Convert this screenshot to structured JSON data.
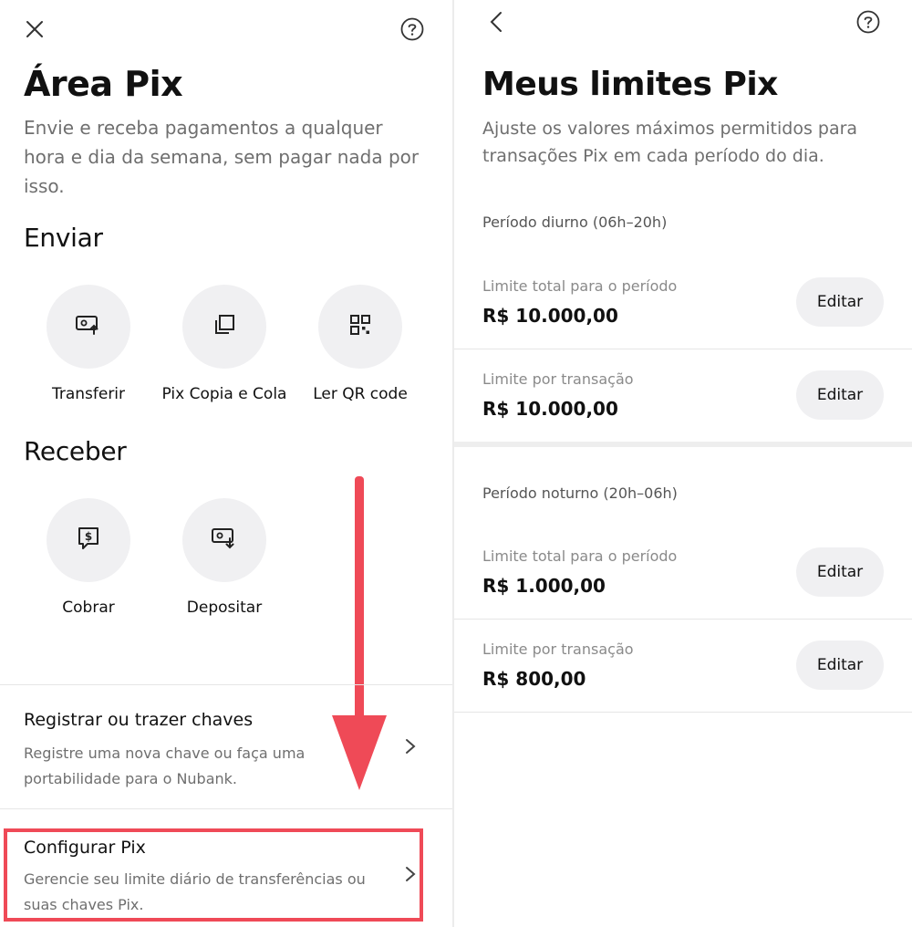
{
  "left": {
    "title": "Área Pix",
    "subtitle": "Envie e receba pagamentos a qualquer hora e dia da semana, sem pagar nada por isso.",
    "send_section": "Enviar",
    "send_actions": [
      {
        "label": "Transferir",
        "icon": "transfer-icon"
      },
      {
        "label": "Pix Copia e Cola",
        "icon": "copy-paste-icon"
      },
      {
        "label": "Ler QR code",
        "icon": "qr-code-icon"
      }
    ],
    "receive_section": "Receber",
    "receive_actions": [
      {
        "label": "Cobrar",
        "icon": "charge-icon"
      },
      {
        "label": "Depositar",
        "icon": "deposit-icon"
      }
    ],
    "list": [
      {
        "title": "Registrar ou trazer chaves",
        "desc": "Registre uma nova chave ou faça uma portabilidade para o Nubank."
      },
      {
        "title": "Configurar Pix",
        "desc": "Gerencie seu limite diário de transferências ou suas chaves Pix."
      }
    ],
    "colors": {
      "highlight": "#ef4a57",
      "arrow": "#ef4a57"
    }
  },
  "right": {
    "title": "Meus limites Pix",
    "subtitle": "Ajuste os valores máximos permitidos para transações Pix em cada período do dia.",
    "periods": [
      {
        "name": "Período diurno (06h–20h)",
        "limits": [
          {
            "label": "Limite total para o período",
            "value": "R$ 10.000,00",
            "button": "Editar"
          },
          {
            "label": "Limite por transação",
            "value": "R$ 10.000,00",
            "button": "Editar"
          }
        ]
      },
      {
        "name": "Período noturno (20h–06h)",
        "limits": [
          {
            "label": "Limite total para o período",
            "value": "R$ 1.000,00",
            "button": "Editar"
          },
          {
            "label": "Limite por transação",
            "value": "R$ 800,00",
            "button": "Editar"
          }
        ]
      }
    ]
  }
}
